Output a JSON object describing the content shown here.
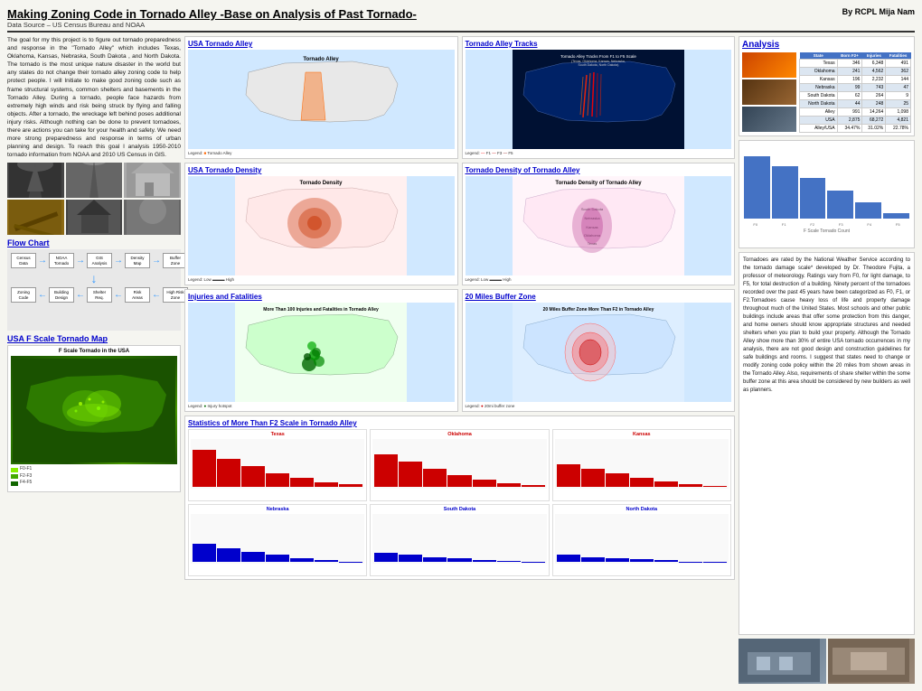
{
  "header": {
    "title": "Making Zoning Code in Tornado Alley -Base on Analysis of Past Tornado-",
    "author": "By RCPL Mija Nam",
    "subtitle": "Data Source – US Census Bureau and NOAA"
  },
  "left": {
    "intro": "The goal for my this project is to figure out tornado preparedness and response in the \"Tornado Alley\" which includes Texas, Oklahoma, Kansas, Nebraska, South Dakota , and North Dakota. The tornado is the most unique nature disaster in the world but any states do not change their tornado alley zoning code to help protect people. I will Initiate to make good zoning code such as frame structural systems, common shelters and basements in the Tornado Alley. During a tornado, people face hazards from extremely high winds and risk being struck by flying and falling objects. After a tornado, the wreckage left behind poses additional injury risks. Although nothing can be done to prevent tornadoes, there are actions you can take for your health and safety. We need more strong preparedness and response in terms of urban planning and design. To reach this goal I analysis 1950-2010 tornado information from NOAA and 2010 US Census in GIS.",
    "flow_chart_title": "Flow Chart",
    "fscale_title": "USA F Scale Tornado Map",
    "fscale_map_label": "F Scale Tornado in the USA"
  },
  "mid": {
    "tornado_alley_title": "USA Tornado Alley",
    "tornado_alley_map_label": "Tornado Alley",
    "tracks_title": "Tornado Alley Tracks",
    "tracks_map_label": "Tornado Alley Tracks From F1 to F5 Scale (Texas, Oklahoma, Kansas, Nebraska, South Dakota, North Dakota)",
    "density_title": "USA Tornado Density",
    "density_map_label": "Tornado Density",
    "density2_title": "Tornado Density of Tornado Alley",
    "density2_map_label": "Tornado Density of Tornado Alley",
    "injuries_title": "Injuries and Fatalities",
    "injuries_map_label": "More Than 100 Injuries and Fatalities in Tornado Alley",
    "buffer_title": "20 Miles Buffer Zone",
    "buffer_map_label": "20 Miles Buffer Zone More Than F2 in Tornado Alley",
    "stats_title": "Statistics of More Than F2 Scale in Tornado Alley",
    "state_charts": [
      {
        "name": "Texas",
        "color": "#cc0000",
        "bars": [
          80,
          60,
          45,
          30,
          20,
          10,
          5
        ]
      },
      {
        "name": "Oklahoma",
        "color": "#cc0000",
        "bars": [
          70,
          55,
          40,
          25,
          15,
          8,
          3
        ]
      },
      {
        "name": "Kansas",
        "color": "#cc0000",
        "bars": [
          50,
          40,
          30,
          20,
          12,
          6,
          2
        ]
      },
      {
        "name": "Nebraska",
        "color": "#0000cc",
        "bars": [
          40,
          30,
          22,
          15,
          8,
          4,
          1
        ]
      },
      {
        "name": "South Dakota",
        "color": "#0000cc",
        "bars": [
          20,
          15,
          10,
          7,
          4,
          2,
          1
        ]
      },
      {
        "name": "North Dakota",
        "color": "#0000cc",
        "bars": [
          15,
          10,
          8,
          5,
          3,
          1,
          1
        ]
      }
    ]
  },
  "right": {
    "analysis_title": "Analysis",
    "table": {
      "headers": [
        "State",
        "Torn F2+",
        "Injuries",
        "Fatalities"
      ],
      "rows": [
        [
          "Texas",
          "346",
          "6,348",
          "491"
        ],
        [
          "Oklahoma",
          "241",
          "4,562",
          "362"
        ],
        [
          "Kansas",
          "196",
          "2,232",
          "144"
        ],
        [
          "Nebraska",
          "99",
          "743",
          "47"
        ],
        [
          "South Dakota",
          "62",
          "264",
          "9"
        ],
        [
          "North Dakota",
          "44",
          "248",
          "25"
        ],
        [
          "Alley",
          "991",
          "14,264",
          "1,098"
        ],
        [
          "USA",
          "2,875",
          "68,272",
          "4,821"
        ],
        [
          "Alley/USA",
          "34.47%",
          "31.02%",
          "22.78%"
        ]
      ]
    },
    "bar_chart_label": "F Scale Tornado Count",
    "bar_data": [
      {
        "label": "F0",
        "value": 85,
        "color": "#4472C4"
      },
      {
        "label": "F1",
        "value": 72,
        "color": "#4472C4"
      },
      {
        "label": "F2",
        "value": 55,
        "color": "#4472C4"
      },
      {
        "label": "F3",
        "value": 38,
        "color": "#4472C4"
      },
      {
        "label": "F4",
        "value": 22,
        "color": "#4472C4"
      },
      {
        "label": "F5",
        "value": 8,
        "color": "#4472C4"
      }
    ],
    "analysis_text": "Tornadoes are rated by the National Weather Service according to the tornado damage scale* developed by Dr. Theodore Fujita, a professor of meteorology. Ratings vary from F0, for light damage, to F5, for total destruction of a building. Ninety percent of the tornadoes recorded over the past 45 years have been categorized as F0, F1, or F2.Tornadoes cause heavy loss of life and property damage throughout much of the United States. Most schools and other public buildings include areas that offer some protection from this danger, and home owners should know appropriate structures and needed shelters when you plan to build your property. Although the Tornado Alley show more than 30% of entire USA tornado occurrences in my analysis, there are not good design and construction guidelines for safe buildings and rooms. I suggest that states need to change or modify zoning code policy within the 20 miles from shown areas in the Tornado Alley. Also, requirements of share shelter within the some buffer zone at this area should be considered by new builders as well as planners."
  }
}
